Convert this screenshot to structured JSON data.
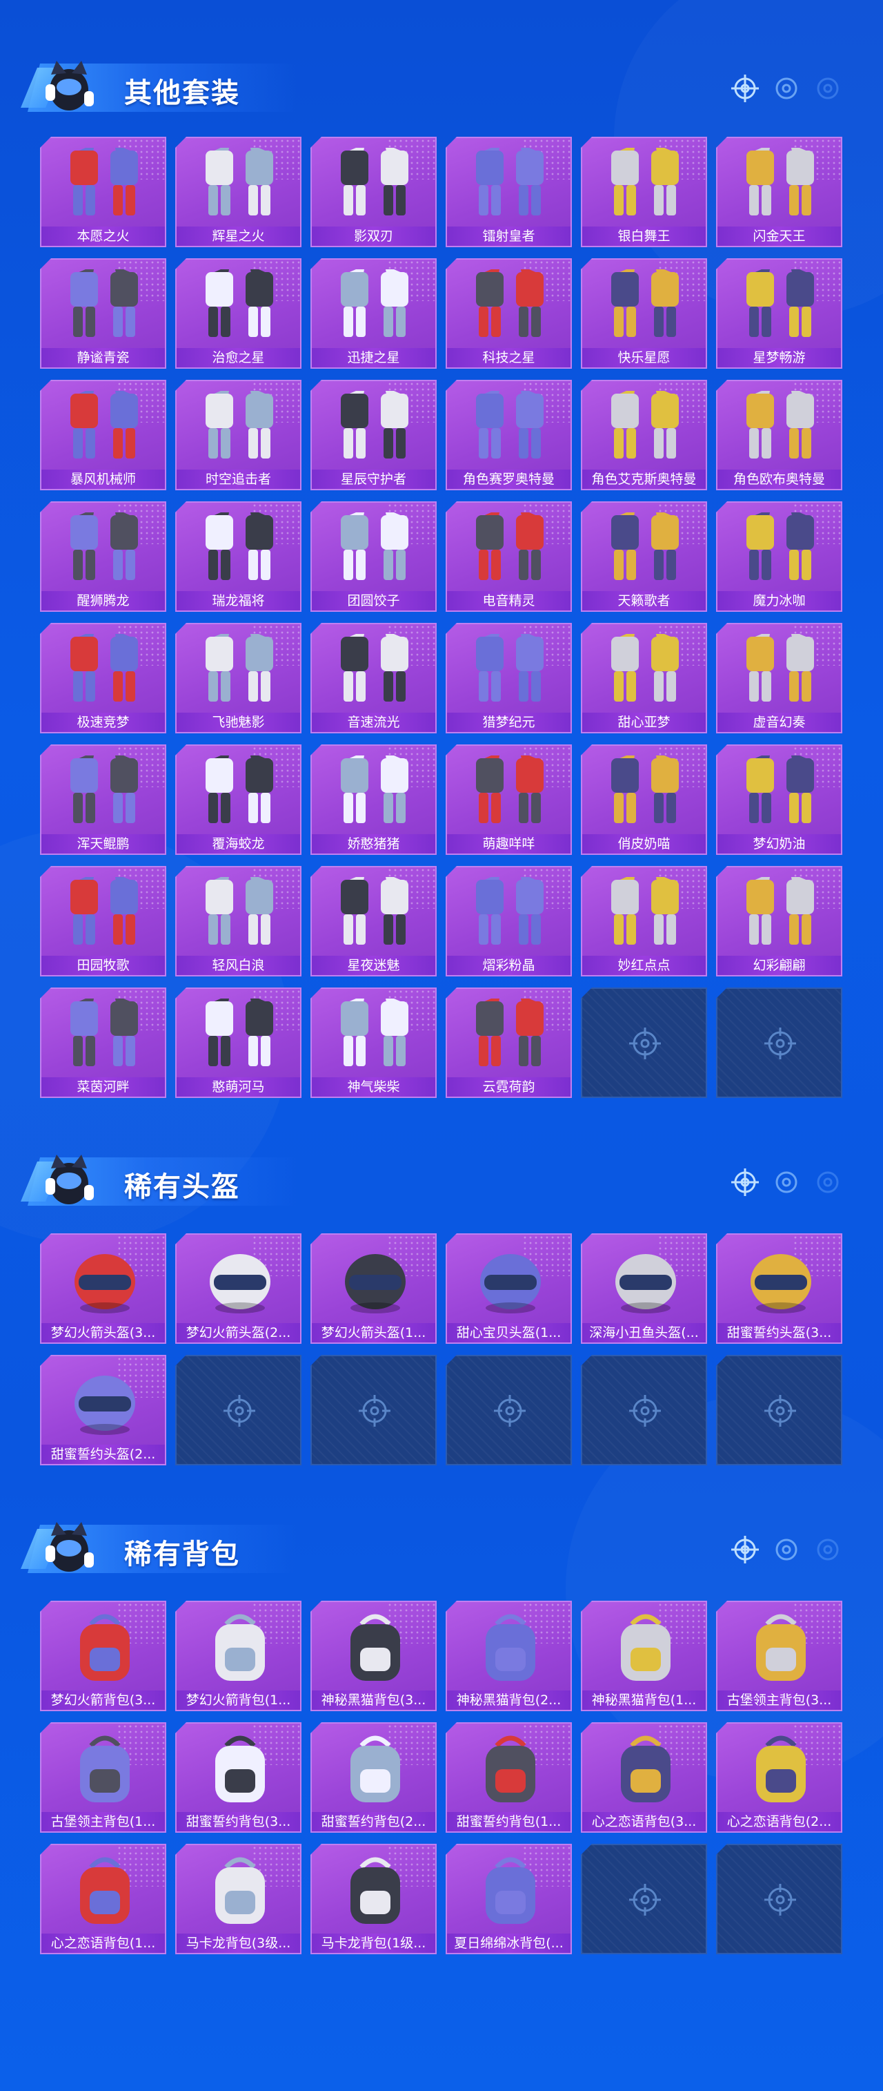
{
  "sections": [
    {
      "id": "suits",
      "title": "其他套装",
      "items": [
        "本愿之火",
        "辉星之火",
        "影双刃",
        "镭射皇者",
        "银白舞王",
        "闪金天王",
        "静谧青瓷",
        "治愈之星",
        "迅捷之星",
        "科技之星",
        "快乐星愿",
        "星梦畅游",
        "暴风机械师",
        "时空追击者",
        "星辰守护者",
        "角色赛罗奥特曼",
        "角色艾克斯奥特曼",
        "角色欧布奥特曼",
        "醒狮腾龙",
        "瑞龙福将",
        "团圆饺子",
        "电音精灵",
        "天籁歌者",
        "魔力冰咖",
        "极速竞梦",
        "飞驰魅影",
        "音速流光",
        "猎梦纪元",
        "甜心亚梦",
        "虚音幻奏",
        "浑天鲲鹏",
        "覆海蛟龙",
        "娇憨猪猪",
        "萌趣咩咩",
        "俏皮奶喵",
        "梦幻奶油",
        "田园牧歌",
        "轻风白浪",
        "星夜迷魅",
        "熠彩粉晶",
        "妙红点点",
        "幻彩翩翩",
        "菜茵河畔",
        "憨萌河马",
        "神气柴柴",
        "云霓荷韵"
      ],
      "empty_slots": 2
    },
    {
      "id": "helmets",
      "title": "稀有头盔",
      "items": [
        "梦幻火箭头盔(3...",
        "梦幻火箭头盔(2...",
        "梦幻火箭头盔(1...",
        "甜心宝贝头盔(1...",
        "深海小丑鱼头盔(...",
        "甜蜜誓约头盔(3...",
        "甜蜜誓约头盔(2..."
      ],
      "empty_slots": 5
    },
    {
      "id": "backpacks",
      "title": "稀有背包",
      "items": [
        "梦幻火箭背包(3...",
        "梦幻火箭背包(1...",
        "神秘黑猫背包(3...",
        "神秘黑猫背包(2...",
        "神秘黑猫背包(1...",
        "古堡领主背包(3...",
        "古堡领主背包(1...",
        "甜蜜誓约背包(3...",
        "甜蜜誓约背包(2...",
        "甜蜜誓约背包(1...",
        "心之恋语背包(3...",
        "心之恋语背包(2...",
        "心之恋语背包(1...",
        "马卡龙背包(3级...",
        "马卡龙背包(1级...",
        "夏日绵绵冰背包(..."
      ],
      "empty_slots": 2
    }
  ],
  "colors": {
    "background": "#0a56e0",
    "card_purple": "#9a44d8",
    "card_label": "#7c2fd0",
    "empty_slot": "#1d3f82"
  },
  "icons": {
    "header_mascot": "mascot-icon",
    "header_deco": "crosshair-icon",
    "empty_slot": "crosshair-icon"
  }
}
